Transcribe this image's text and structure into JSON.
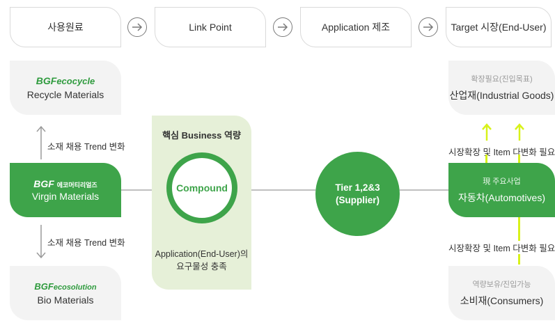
{
  "tabs": [
    "사용원료",
    "Link Point",
    "Application 제조",
    "Target 시장(End-User)"
  ],
  "materials": {
    "recycle": {
      "brand": "BGF",
      "sub": "ecocycle",
      "label": "Recycle Materials"
    },
    "virgin": {
      "brand": "BGF",
      "sub": "에코머티리얼즈",
      "label": "Virgin Materials"
    },
    "bio": {
      "brand": "BGF",
      "sub": "ecosolution",
      "label": "Bio Materials"
    }
  },
  "trend_up": "소재 채용 Trend 변화",
  "trend_down": "소재 채용 Trend 변화",
  "core": {
    "title": "핵심 Business 역량",
    "circle": "Compound",
    "desc_line1": "Application(End-User)의",
    "desc_line2": "요구물성 충족"
  },
  "tier": {
    "line1": "Tier 1,2&3",
    "line2": "(Supplier)"
  },
  "markets": {
    "industrial": {
      "tag": "확장필요(진입목표)",
      "label": "산업재(Industrial Goods)"
    },
    "automotive": {
      "tag": "現 주요사업",
      "label": "자동차(Automotives)"
    },
    "consumer": {
      "tag": "역량보유/진입가능",
      "label": "소비재(Consumers)"
    }
  },
  "expand_top": "시장확장 및 Item 다변화 필요",
  "expand_bottom": "시장확장 및 Item 다변화 필요",
  "colors": {
    "green": "#3ea44a",
    "light_green": "#e6f0d8",
    "yellow": "#d8f21a",
    "gray": "#f3f3f3"
  }
}
